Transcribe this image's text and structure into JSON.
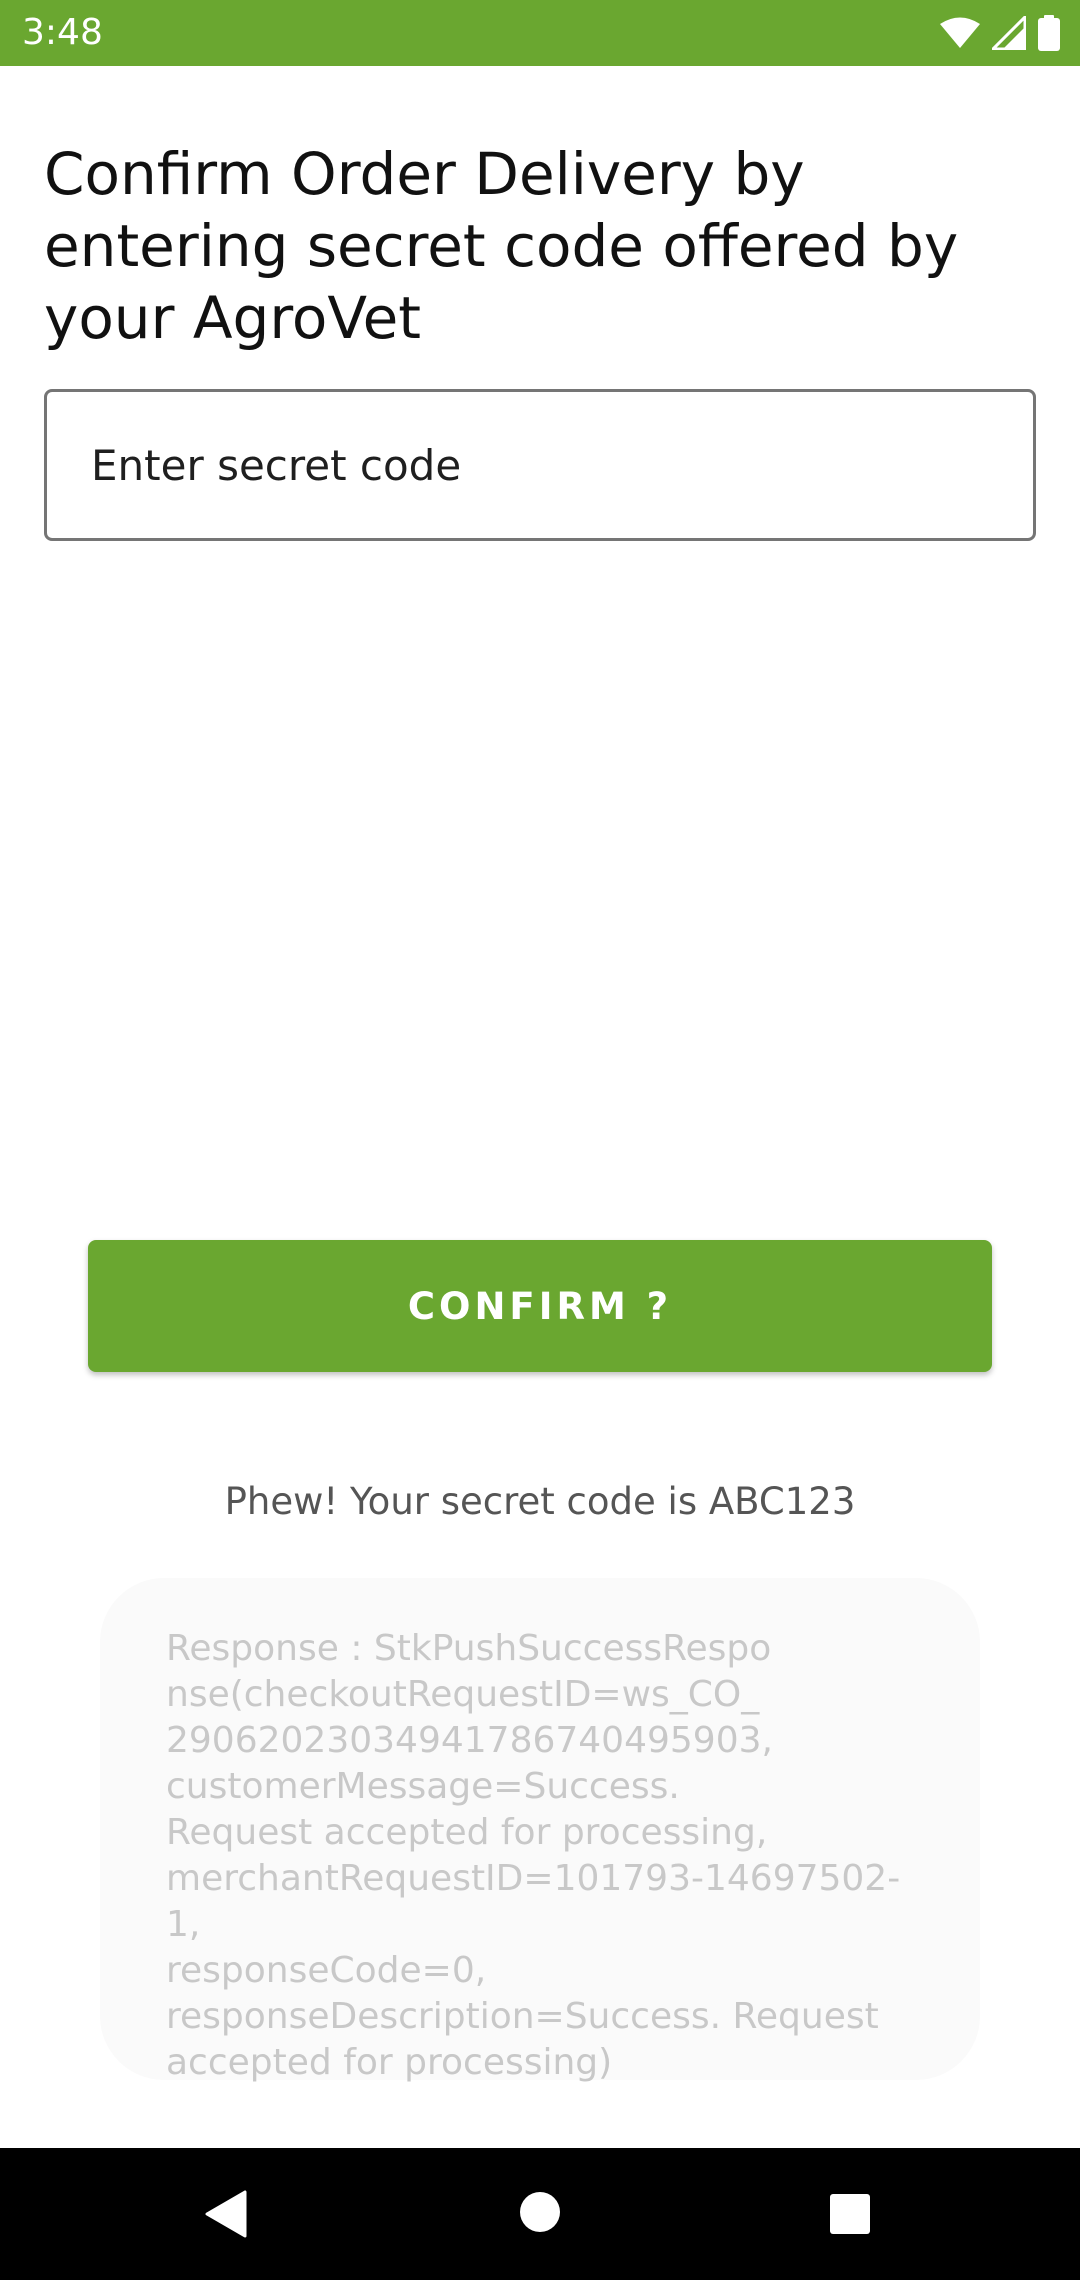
{
  "status_bar": {
    "time": "3:48",
    "background_color": "#6aa730",
    "icons": [
      "wifi-icon",
      "cellular-signal-icon",
      "battery-icon"
    ]
  },
  "screen": {
    "heading": "Confirm Order Delivery by entering secret code offered by your AgroVet",
    "secret_code_input": {
      "value": "",
      "placeholder": "Enter secret code"
    },
    "confirm_button_label": "CONFIRM ?",
    "secret_code_message": "Phew! Your secret code is ABC123",
    "response_text": "Response : StkPushSuccessRespo\nnse(checkoutRequestID=ws_CO_\n29062023034941786740495903,\ncustomerMessage=Success.\nRequest accepted for processing,\nmerchantRequestID=101793-14697502-1,\nresponseCode=0,\nresponseDescription=Success. Request\naccepted for processing)"
  },
  "colors": {
    "accent": "#6aa730",
    "text_primary": "#111111",
    "text_secondary": "#555555",
    "response_text": "#c8c8c8"
  },
  "nav_bar": {
    "icons": [
      "back-icon",
      "home-icon",
      "recents-icon"
    ]
  }
}
